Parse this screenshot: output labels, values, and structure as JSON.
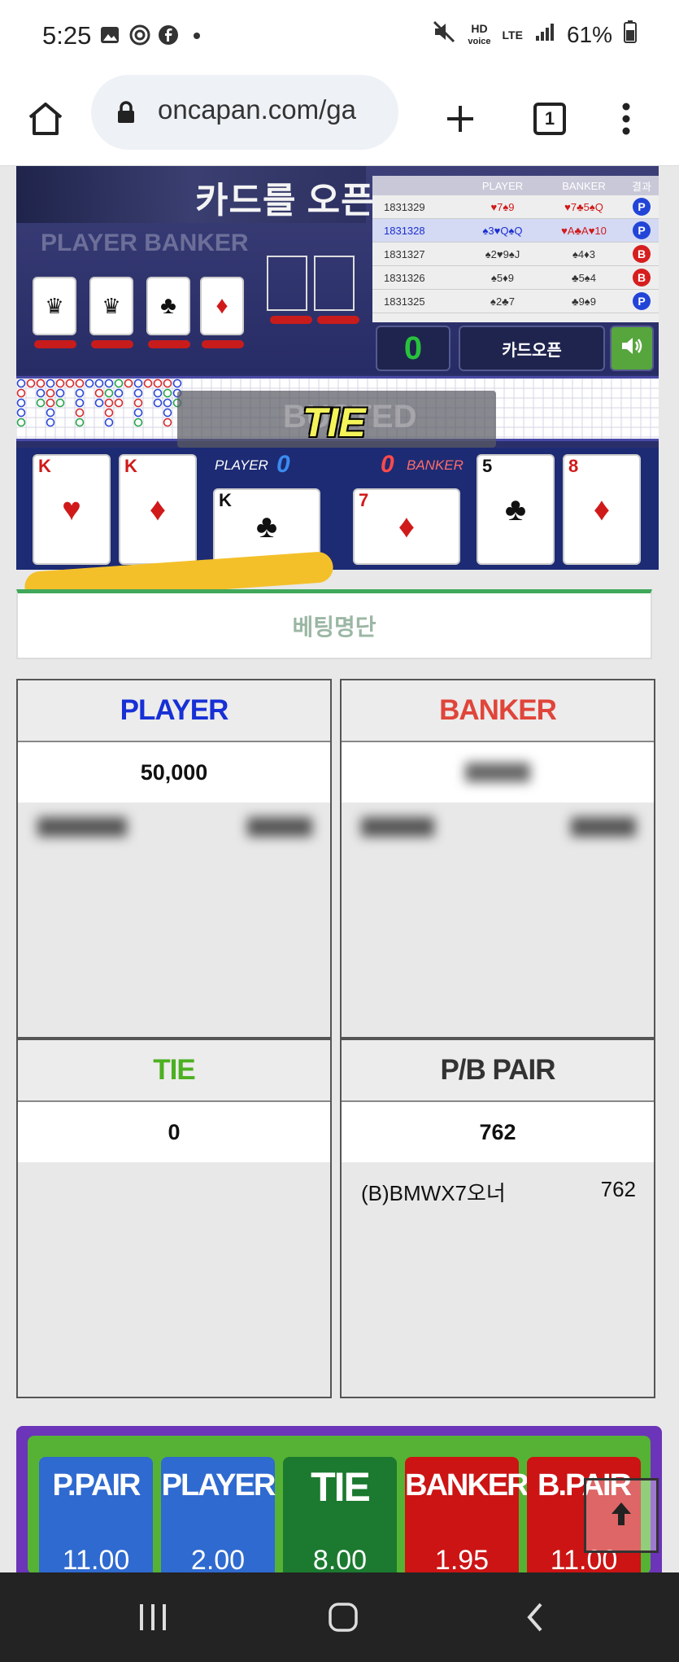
{
  "status_bar": {
    "time": "5:25",
    "battery": "61%",
    "network_hd": "HD",
    "network_voice": "voice",
    "network_lte": "LTE"
  },
  "browser": {
    "url": "oncapan.com/ga",
    "tab_count": "1"
  },
  "game": {
    "announcement": "카드를 오픈합니다.",
    "shoe_title": "PLAYER BANKER",
    "history": {
      "headers": [
        "PLAYER",
        "BANKER",
        "결과"
      ],
      "rows": [
        {
          "id": "1831329",
          "player": "♥7♠9",
          "banker": "♥7♣5♠Q",
          "result": "P"
        },
        {
          "id": "1831328",
          "player": "♠3♥Q♠Q",
          "banker": "♥A♣A♥10",
          "result": "P"
        },
        {
          "id": "1831327",
          "player": "♠2♥9♠J",
          "banker": "♠4♦3",
          "result": "B"
        },
        {
          "id": "1831326",
          "player": "♠5♦9",
          "banker": "♣5♠4",
          "result": "B"
        },
        {
          "id": "1831325",
          "player": "♠2♣7",
          "banker": "♣9♠9",
          "result": "P"
        }
      ]
    },
    "counter": "0",
    "open_button": "카드오픈",
    "banner_bg_word": "BUSTED",
    "result_text": "TIE",
    "player_label": "PLAYER",
    "banker_label": "BANKER",
    "player_score": "0",
    "banker_score": "0",
    "player_cards": [
      {
        "rank": "K",
        "suit": "♥",
        "color": "red"
      },
      {
        "rank": "K",
        "suit": "♦",
        "color": "red"
      },
      {
        "rank": "K",
        "suit": "♣",
        "color": "black"
      }
    ],
    "banker_cards": [
      {
        "rank": "7",
        "suit": "♦",
        "color": "red"
      },
      {
        "rank": "5",
        "suit": "♣",
        "color": "black"
      },
      {
        "rank": "8",
        "suit": "♦",
        "color": "red"
      }
    ]
  },
  "bet_list_title": "베팅명단",
  "panels": {
    "player": {
      "title": "PLAYER",
      "title_color": "#1730d6",
      "total": "50,000"
    },
    "banker": {
      "title": "BANKER",
      "title_color": "#e0453a",
      "total": ""
    },
    "tie": {
      "title": "TIE",
      "title_color": "#4cb020",
      "total": "0"
    },
    "pair": {
      "title": "P/B PAIR",
      "title_color": "#333333",
      "total": "762",
      "entries": [
        {
          "name": "(B)BMWX7오너",
          "amount": "762"
        }
      ]
    }
  },
  "odds": [
    {
      "name": "P.PAIR",
      "value": "11.00",
      "color": "#2f6ad0"
    },
    {
      "name": "PLAYER",
      "value": "2.00",
      "color": "#2f6ad0"
    },
    {
      "name": "TIE",
      "value": "8.00",
      "color": "#1b7a2f"
    },
    {
      "name": "BANKER",
      "value": "1.95",
      "color": "#cc1414"
    },
    {
      "name": "B.PAIR",
      "value": "11.00",
      "color": "#cc1414"
    }
  ]
}
